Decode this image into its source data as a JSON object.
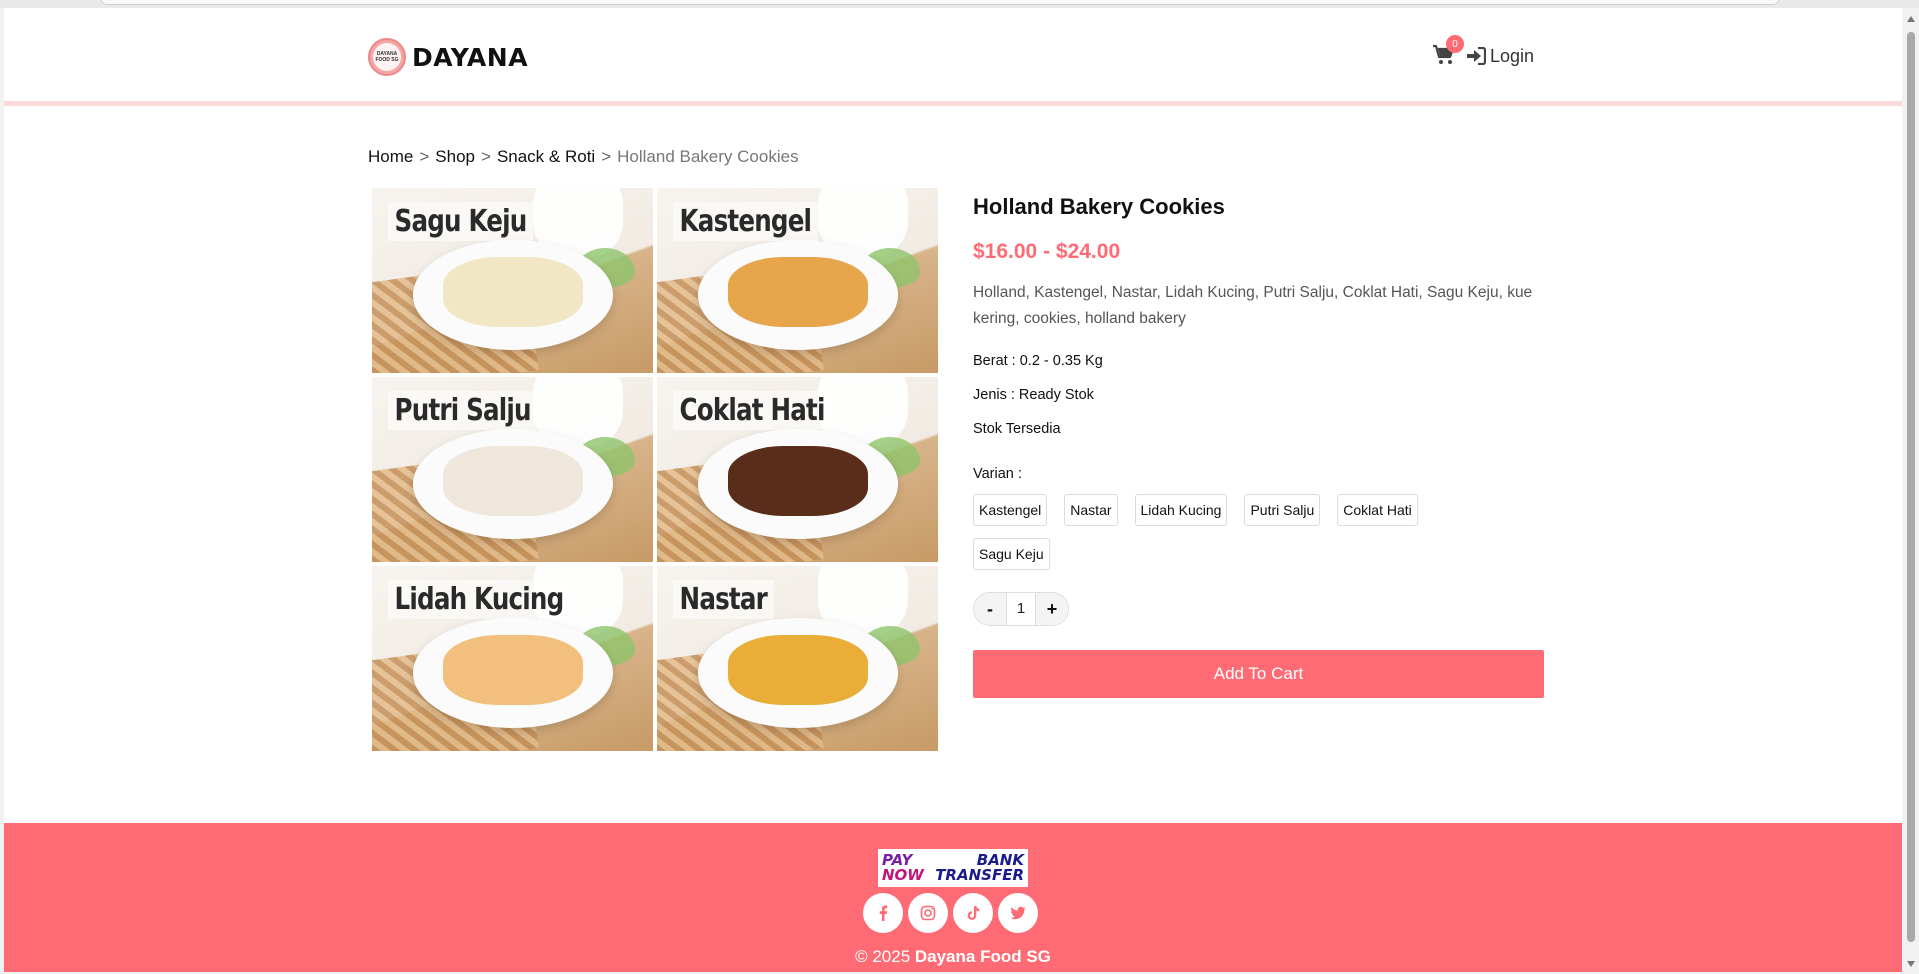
{
  "header": {
    "logo_text": "DAYANA",
    "logo_badge_text": "DAYANA FOOD SG",
    "cart_count": "0",
    "login_label": "Login"
  },
  "breadcrumb": {
    "items": [
      "Home",
      "Shop",
      "Snack & Roti"
    ],
    "separator": ">",
    "current": "Holland Bakery Cookies"
  },
  "gallery": {
    "tiles": [
      {
        "label": "Sagu Keju",
        "food_color": "#f2e7c4"
      },
      {
        "label": "Kastengel",
        "food_color": "#e7a54c"
      },
      {
        "label": "Putri Salju",
        "food_color": "#efe6dc"
      },
      {
        "label": "Coklat Hati",
        "food_color": "#5a2c1a"
      },
      {
        "label": "Lidah Kucing",
        "food_color": "#f2c07c"
      },
      {
        "label": "Nastar",
        "food_color": "#e9ad38"
      }
    ]
  },
  "product": {
    "title": "Holland Bakery Cookies",
    "price": "$16.00 - $24.00",
    "description": "Holland, Kastengel, Nastar, Lidah Kucing, Putri Salju, Coklat Hati, Sagu Keju, kue kering, cookies, holland bakery",
    "weight": "Berat : 0.2 - 0.35 Kg",
    "type": "Jenis : Ready Stok",
    "stock": "Stok Tersedia",
    "variant_label": "Varian :",
    "variants": [
      "Kastengel",
      "Nastar",
      "Lidah Kucing",
      "Putri Salju",
      "Coklat Hati",
      "Sagu Keju"
    ],
    "quantity": {
      "minus": "-",
      "value": "1",
      "plus": "+"
    },
    "add_to_cart_label": "Add To Cart"
  },
  "footer": {
    "payments": {
      "paynow_pay": "PAY",
      "paynow_now": "NOW",
      "bank_line1": "BANK",
      "bank_line2": "TRANSFER"
    },
    "socials": [
      "facebook-icon",
      "instagram-icon",
      "tiktok-icon",
      "twitter-icon"
    ],
    "copyright_prefix": "© 2025 ",
    "copyright_brand": "Dayana Food SG"
  },
  "colors": {
    "accent": "#ff6b75",
    "header_border": "#fcdada"
  }
}
